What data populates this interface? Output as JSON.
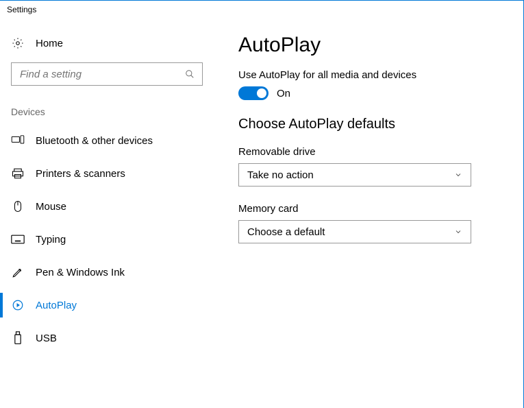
{
  "window": {
    "title": "Settings"
  },
  "sidebar": {
    "home_label": "Home",
    "search_placeholder": "Find a setting",
    "category_label": "Devices",
    "items": [
      {
        "label": "Bluetooth & other devices",
        "icon": "bluetooth-devices-icon",
        "active": false
      },
      {
        "label": "Printers & scanners",
        "icon": "printer-icon",
        "active": false
      },
      {
        "label": "Mouse",
        "icon": "mouse-icon",
        "active": false
      },
      {
        "label": "Typing",
        "icon": "keyboard-icon",
        "active": false
      },
      {
        "label": "Pen & Windows Ink",
        "icon": "pen-icon",
        "active": false
      },
      {
        "label": "AutoPlay",
        "icon": "autoplay-icon",
        "active": true
      },
      {
        "label": "USB",
        "icon": "usb-icon",
        "active": false
      }
    ]
  },
  "main": {
    "title": "AutoPlay",
    "toggle_label": "Use AutoPlay for all media and devices",
    "toggle_state_label": "On",
    "toggle_on": true,
    "section_heading": "Choose AutoPlay defaults",
    "dropdowns": [
      {
        "label": "Removable drive",
        "value": "Take no action"
      },
      {
        "label": "Memory card",
        "value": "Choose a default"
      }
    ]
  }
}
